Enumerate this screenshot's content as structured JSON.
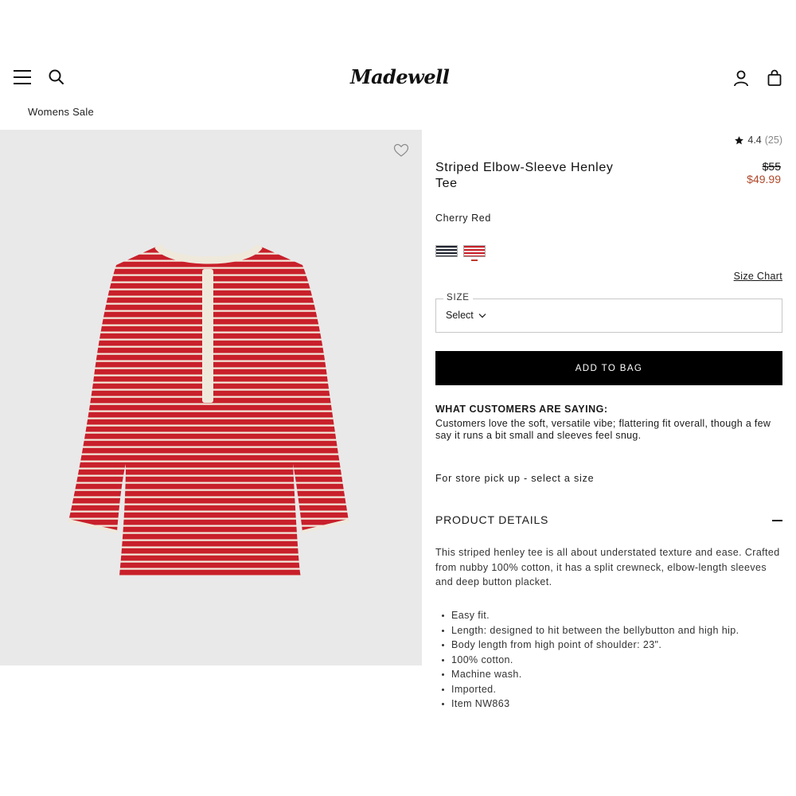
{
  "header": {
    "logo": "Madewell",
    "icons": [
      "menu-icon",
      "search-icon",
      "account-icon",
      "bag-icon"
    ]
  },
  "breadcrumb": "Womens Sale",
  "product": {
    "rating": "4.4",
    "review_count": "(25)",
    "title": "Striped Elbow-Sleeve Henley Tee",
    "price_original": "$55",
    "price_sale": "$49.99",
    "color_name": "Cherry Red",
    "swatches": [
      {
        "name": "navy stripe",
        "color": "#1f2430"
      },
      {
        "name": "cherry red stripe",
        "color": "#c8202b",
        "selected": true
      }
    ],
    "size_chart_label": "Size Chart",
    "size_label": "SIZE",
    "size_value": "Select",
    "add_to_bag": "ADD TO BAG",
    "reviews_heading": "WHAT CUSTOMERS ARE SAYING:",
    "reviews_summary": "Customers love the soft, versatile vibe; flattering fit overall, though a few say it runs a bit small and sleeves feel snug.",
    "pickup_text": "For store pick up - select a size",
    "details_heading": "PRODUCT DETAILS",
    "details_description": "This striped henley tee is all about understated texture and ease. Crafted from nubby 100% cotton, it has a split crewneck, elbow-length sleeves and deep button placket.",
    "details_bullets": [
      "Easy fit.",
      "Length: designed to hit between the bellybutton and high hip.",
      "Body length from high point of shoulder: 23\".",
      "100% cotton.",
      "Machine wash.",
      "Imported.",
      "Item NW863"
    ]
  },
  "colors": {
    "sale_price": "#b04a2c",
    "button_bg": "#000000",
    "gallery_bg": "#e9e9e9",
    "shirt_red": "#c8202b",
    "shirt_trim": "#efe9dc"
  }
}
